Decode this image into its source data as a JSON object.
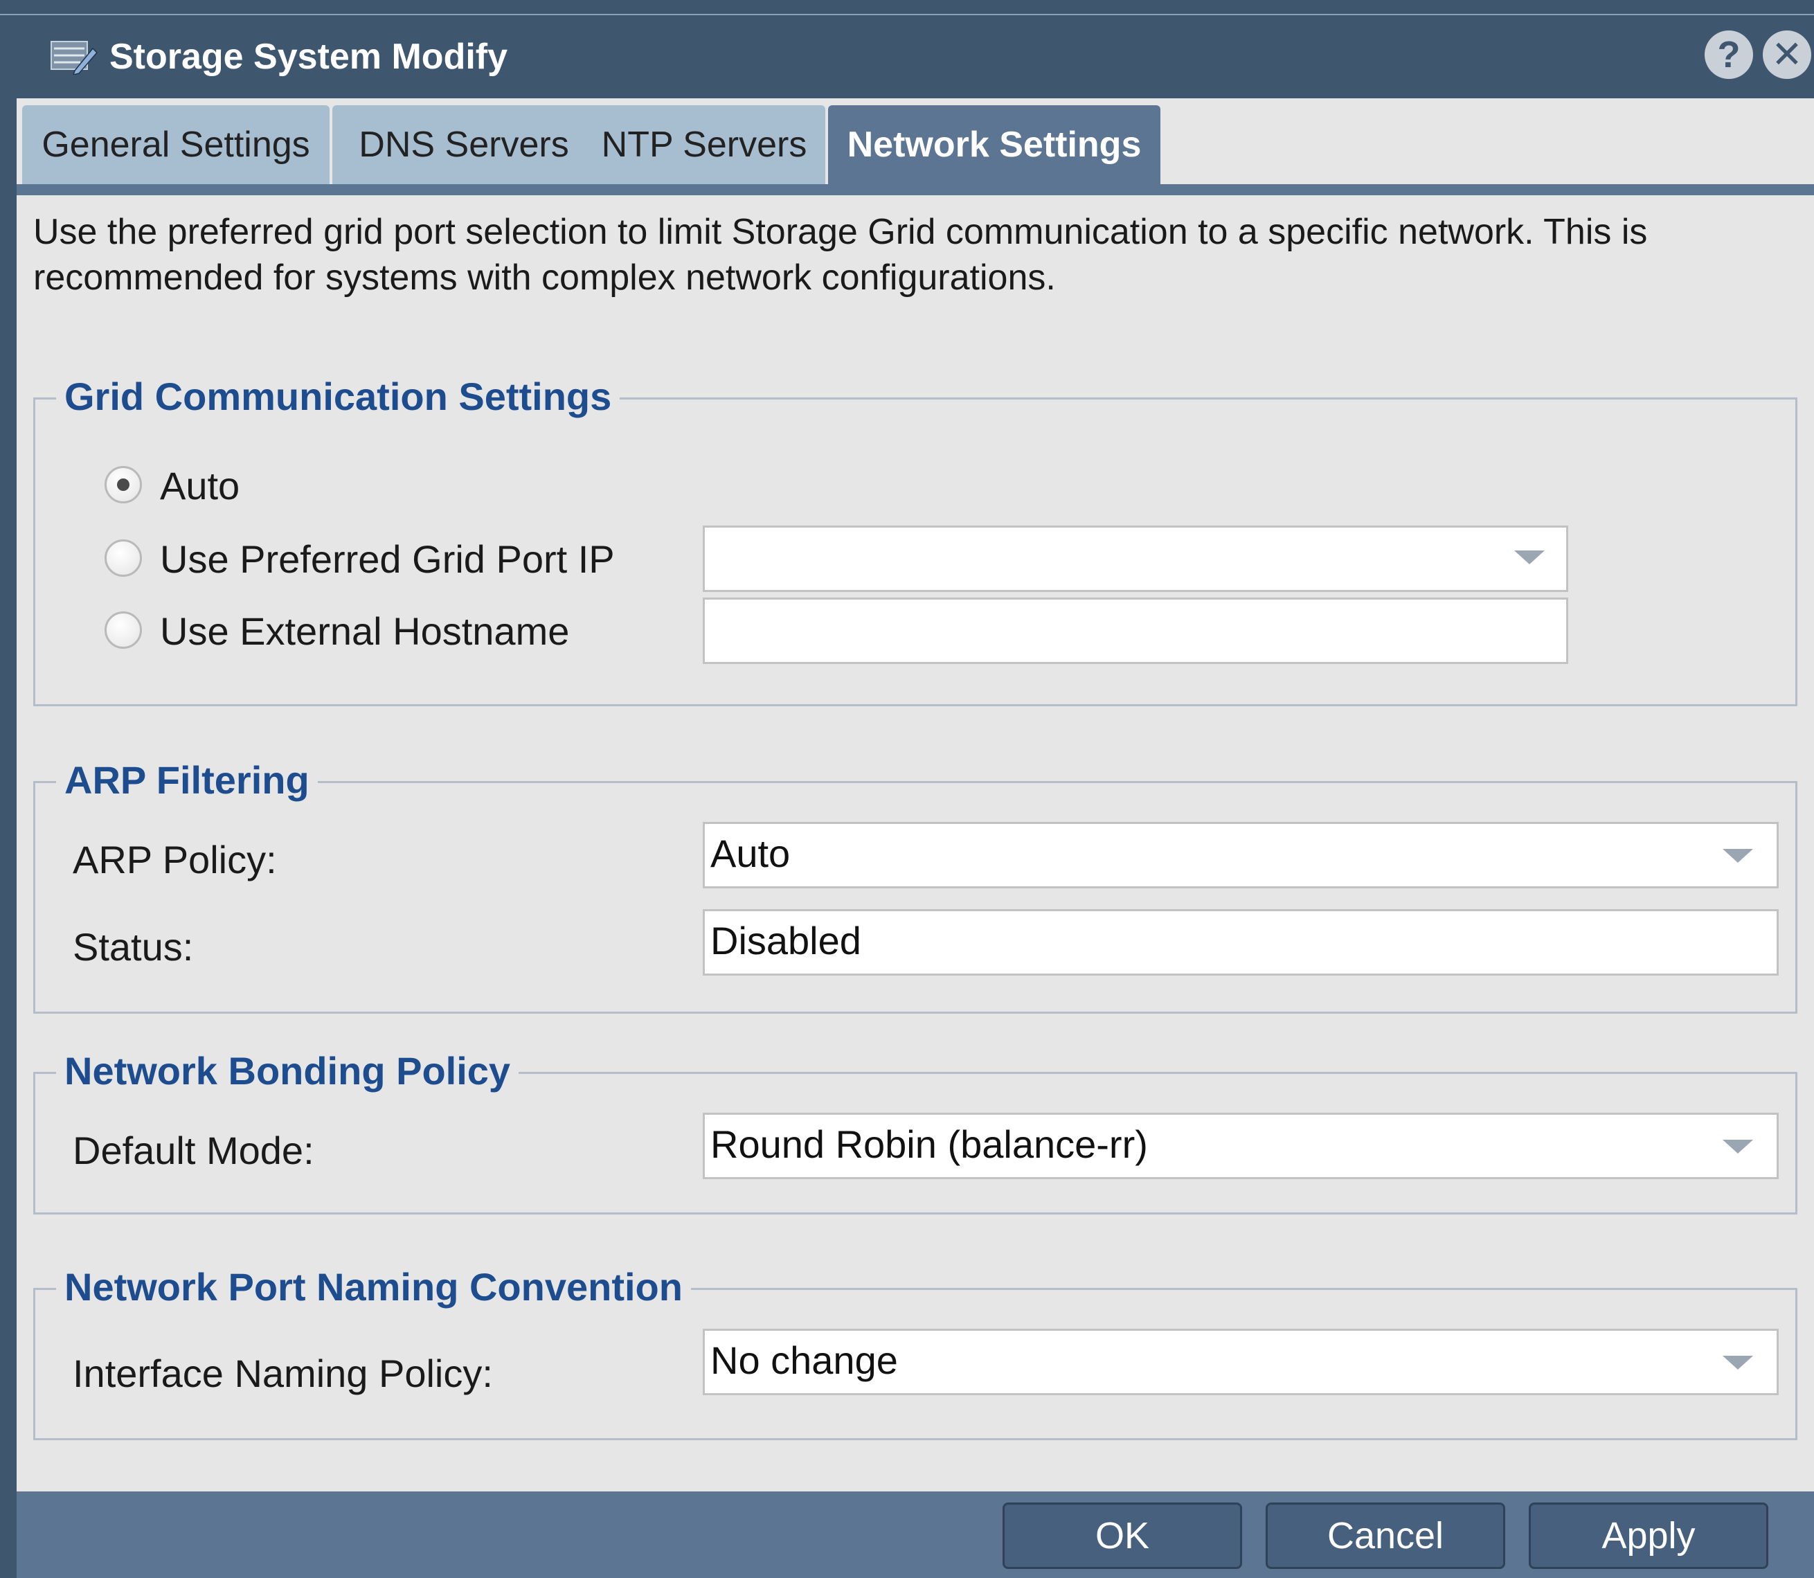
{
  "window": {
    "title": "Storage System Modify",
    "icon": "storage-edit-icon",
    "help_glyph": "?",
    "close_glyph": "✕"
  },
  "tabs": [
    {
      "label": "General Settings",
      "active": false
    },
    {
      "label": "DNS Servers",
      "active": false
    },
    {
      "label": "NTP Servers",
      "active": false
    },
    {
      "label": "Network Settings",
      "active": true
    }
  ],
  "intro_text": "Use the preferred grid port selection to limit Storage Grid communication to a specific network. This is recommended for systems with complex network configurations.",
  "grid_communication": {
    "legend": "Grid Communication Settings",
    "options": [
      {
        "label": "Auto",
        "selected": true
      },
      {
        "label": "Use Preferred Grid Port IP",
        "selected": false
      },
      {
        "label": "Use External Hostname",
        "selected": false
      }
    ],
    "preferred_port_value": "",
    "external_hostname_value": ""
  },
  "arp_filtering": {
    "legend": "ARP Filtering",
    "policy_label": "ARP Policy:",
    "policy_value": "Auto",
    "status_label": "Status:",
    "status_value": "Disabled"
  },
  "network_bonding": {
    "legend": "Network Bonding Policy",
    "mode_label": "Default Mode:",
    "mode_value": "Round Robin (balance-rr)"
  },
  "port_naming": {
    "legend": "Network Port Naming Convention",
    "policy_label": "Interface Naming Policy:",
    "policy_value": "No change"
  },
  "footer": {
    "ok_label": "OK",
    "cancel_label": "Cancel",
    "apply_label": "Apply"
  }
}
